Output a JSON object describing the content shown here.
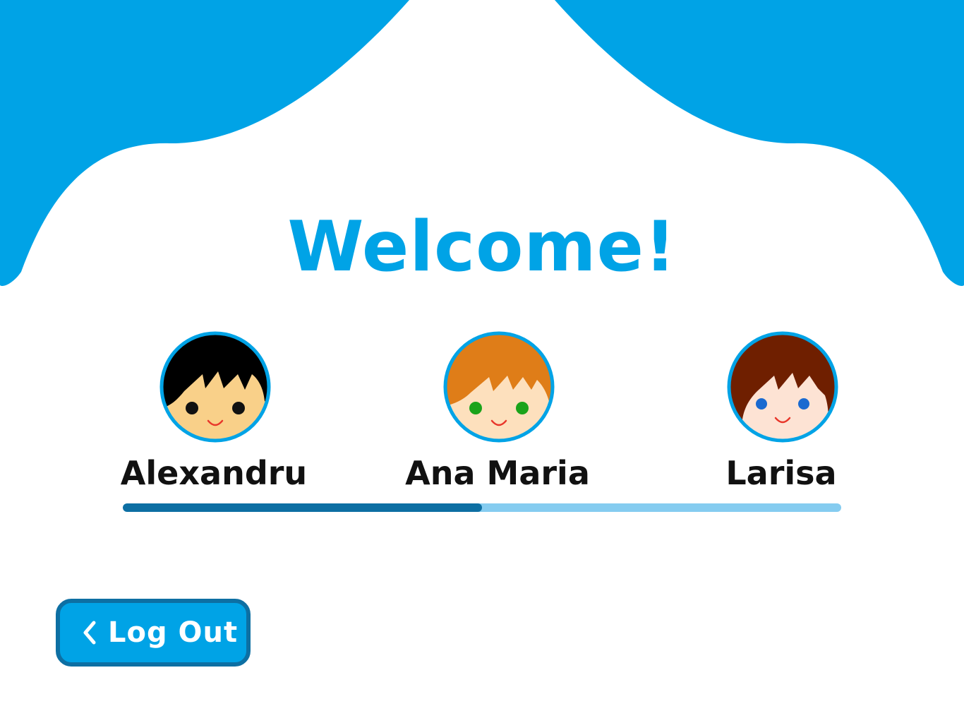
{
  "title": "Welcome!",
  "profiles": [
    {
      "name": "Alexandru",
      "hair_color": "#000000",
      "skin_color": "#f9d089",
      "eye_color": "#111111"
    },
    {
      "name": "Ana Maria",
      "hair_color": "#df7d18",
      "skin_color": "#fde0bd",
      "eye_color": "#1aa31a"
    },
    {
      "name": "Larisa",
      "hair_color": "#6f1f00",
      "skin_color": "#fde3d4",
      "eye_color": "#1a6ad0"
    }
  ],
  "progress": {
    "fraction": 0.5
  },
  "logout": {
    "label": "Log Out",
    "icon": "chevron-left-icon"
  },
  "colors": {
    "accent": "#00a3e6",
    "accent_dark": "#0d6fa3",
    "track_light": "#85ccf0",
    "text_dark": "#111111",
    "background": "#ffffff",
    "mouth": "#e8362a"
  }
}
